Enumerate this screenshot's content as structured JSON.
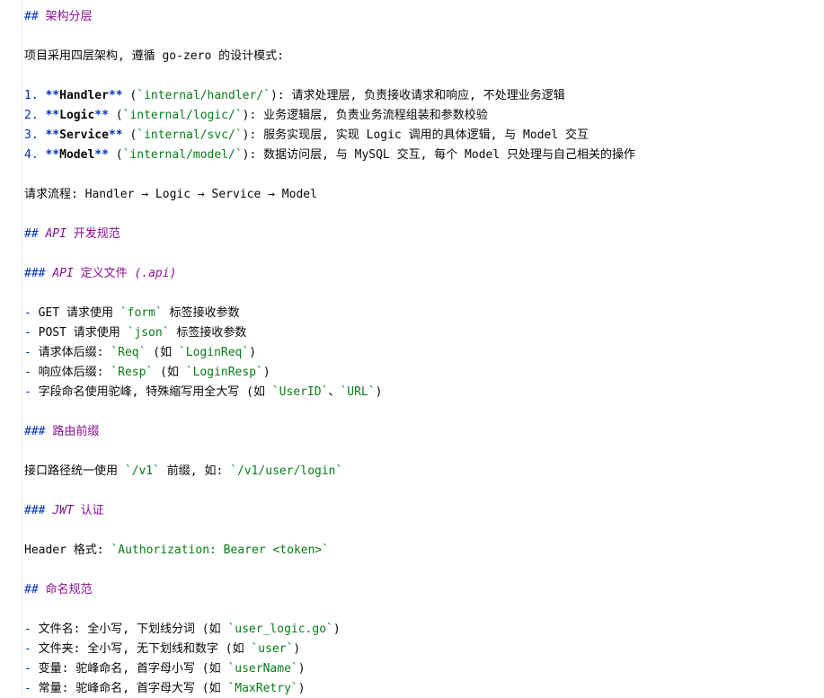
{
  "doc": {
    "lines": [
      [
        {
          "t": "## ",
          "c": "head"
        },
        {
          "t": "架构分层",
          "c": "head-text"
        }
      ],
      [],
      [
        {
          "t": "项目采用四层架构, 遵循 go-zero 的设计模式:",
          "c": "txt"
        }
      ],
      [],
      [
        {
          "t": "1. ",
          "c": "num"
        },
        {
          "t": "**",
          "c": "star"
        },
        {
          "t": "Handler",
          "c": "bold"
        },
        {
          "t": "**",
          "c": "star"
        },
        {
          "t": " (",
          "c": "txt"
        },
        {
          "t": "`",
          "c": "bt"
        },
        {
          "t": "internal/handler/",
          "c": "code"
        },
        {
          "t": "`",
          "c": "bt"
        },
        {
          "t": "): 请求处理层, 负责接收请求和响应, 不处理业务逻辑",
          "c": "txt"
        }
      ],
      [
        {
          "t": "2. ",
          "c": "num"
        },
        {
          "t": "**",
          "c": "star"
        },
        {
          "t": "Logic",
          "c": "bold"
        },
        {
          "t": "**",
          "c": "star"
        },
        {
          "t": " (",
          "c": "txt"
        },
        {
          "t": "`",
          "c": "bt"
        },
        {
          "t": "internal/logic/",
          "c": "code"
        },
        {
          "t": "`",
          "c": "bt"
        },
        {
          "t": "): 业务逻辑层, 负责业务流程组装和参数校验",
          "c": "txt"
        }
      ],
      [
        {
          "t": "3. ",
          "c": "num"
        },
        {
          "t": "**",
          "c": "star"
        },
        {
          "t": "Service",
          "c": "bold"
        },
        {
          "t": "**",
          "c": "star"
        },
        {
          "t": " (",
          "c": "txt"
        },
        {
          "t": "`",
          "c": "bt"
        },
        {
          "t": "internal/svc/",
          "c": "code"
        },
        {
          "t": "`",
          "c": "bt"
        },
        {
          "t": "): 服务实现层, 实现 Logic 调用的具体逻辑, 与 Model 交互",
          "c": "txt"
        }
      ],
      [
        {
          "t": "4. ",
          "c": "num"
        },
        {
          "t": "**",
          "c": "star"
        },
        {
          "t": "Model",
          "c": "bold"
        },
        {
          "t": "**",
          "c": "star"
        },
        {
          "t": " (",
          "c": "txt"
        },
        {
          "t": "`",
          "c": "bt"
        },
        {
          "t": "internal/model/",
          "c": "code"
        },
        {
          "t": "`",
          "c": "bt"
        },
        {
          "t": "): 数据访问层, 与 MySQL 交互, 每个 Model 只处理与自己相关的操作",
          "c": "txt"
        }
      ],
      [],
      [
        {
          "t": "请求流程: Handler → Logic → Service → Model",
          "c": "txt"
        }
      ],
      [],
      [
        {
          "t": "## ",
          "c": "head"
        },
        {
          "t": "API",
          "c": "head-text it"
        },
        {
          "t": " 开发规范",
          "c": "head-text"
        }
      ],
      [],
      [
        {
          "t": "### ",
          "c": "head"
        },
        {
          "t": "API",
          "c": "head-text it"
        },
        {
          "t": " 定义文件 ",
          "c": "head-text"
        },
        {
          "t": "(.api)",
          "c": "head-text it"
        }
      ],
      [],
      [
        {
          "t": "- ",
          "c": "dash"
        },
        {
          "t": "GET 请求使用 ",
          "c": "txt"
        },
        {
          "t": "`",
          "c": "bt"
        },
        {
          "t": "form",
          "c": "code"
        },
        {
          "t": "`",
          "c": "bt"
        },
        {
          "t": " 标签接收参数",
          "c": "txt"
        }
      ],
      [
        {
          "t": "- ",
          "c": "dash"
        },
        {
          "t": "POST 请求使用 ",
          "c": "txt"
        },
        {
          "t": "`",
          "c": "bt"
        },
        {
          "t": "json",
          "c": "code"
        },
        {
          "t": "`",
          "c": "bt"
        },
        {
          "t": " 标签接收参数",
          "c": "txt"
        }
      ],
      [
        {
          "t": "- ",
          "c": "dash"
        },
        {
          "t": "请求体后缀: ",
          "c": "txt"
        },
        {
          "t": "`",
          "c": "bt"
        },
        {
          "t": "Req",
          "c": "code"
        },
        {
          "t": "`",
          "c": "bt"
        },
        {
          "t": " (如 ",
          "c": "txt"
        },
        {
          "t": "`",
          "c": "bt"
        },
        {
          "t": "LoginReq",
          "c": "code"
        },
        {
          "t": "`",
          "c": "bt"
        },
        {
          "t": ")",
          "c": "txt"
        }
      ],
      [
        {
          "t": "- ",
          "c": "dash"
        },
        {
          "t": "响应体后缀: ",
          "c": "txt"
        },
        {
          "t": "`",
          "c": "bt"
        },
        {
          "t": "Resp",
          "c": "code"
        },
        {
          "t": "`",
          "c": "bt"
        },
        {
          "t": " (如 ",
          "c": "txt"
        },
        {
          "t": "`",
          "c": "bt"
        },
        {
          "t": "LoginResp",
          "c": "code"
        },
        {
          "t": "`",
          "c": "bt"
        },
        {
          "t": ")",
          "c": "txt"
        }
      ],
      [
        {
          "t": "- ",
          "c": "dash"
        },
        {
          "t": "字段命名使用驼峰, 特殊缩写用全大写 (如 ",
          "c": "txt"
        },
        {
          "t": "`",
          "c": "bt"
        },
        {
          "t": "UserID",
          "c": "code"
        },
        {
          "t": "`",
          "c": "bt"
        },
        {
          "t": "、",
          "c": "txt"
        },
        {
          "t": "`",
          "c": "bt"
        },
        {
          "t": "URL",
          "c": "code"
        },
        {
          "t": "`",
          "c": "bt"
        },
        {
          "t": ")",
          "c": "txt"
        }
      ],
      [],
      [
        {
          "t": "### ",
          "c": "head"
        },
        {
          "t": "路由前缀",
          "c": "head-text"
        }
      ],
      [],
      [
        {
          "t": "接口路径统一使用 ",
          "c": "txt"
        },
        {
          "t": "`",
          "c": "bt"
        },
        {
          "t": "/v1",
          "c": "code"
        },
        {
          "t": "`",
          "c": "bt"
        },
        {
          "t": " 前缀, 如: ",
          "c": "txt"
        },
        {
          "t": "`",
          "c": "bt"
        },
        {
          "t": "/v1/user/login",
          "c": "code"
        },
        {
          "t": "`",
          "c": "bt"
        }
      ],
      [],
      [
        {
          "t": "### ",
          "c": "head"
        },
        {
          "t": "JWT",
          "c": "head-text it"
        },
        {
          "t": " 认证",
          "c": "head-text"
        }
      ],
      [],
      [
        {
          "t": "Header 格式: ",
          "c": "txt"
        },
        {
          "t": "`",
          "c": "bt"
        },
        {
          "t": "Authorization: Bearer <token>",
          "c": "code"
        },
        {
          "t": "`",
          "c": "bt"
        }
      ],
      [],
      [
        {
          "t": "## ",
          "c": "head"
        },
        {
          "t": "命名规范",
          "c": "head-text"
        }
      ],
      [],
      [
        {
          "t": "- ",
          "c": "dash"
        },
        {
          "t": "文件名: 全小写, 下划线分词 (如 ",
          "c": "txt"
        },
        {
          "t": "`",
          "c": "bt"
        },
        {
          "t": "user_logic.go",
          "c": "code"
        },
        {
          "t": "`",
          "c": "bt"
        },
        {
          "t": ")",
          "c": "txt"
        }
      ],
      [
        {
          "t": "- ",
          "c": "dash"
        },
        {
          "t": "文件夹: 全小写, 无下划线和数字 (如 ",
          "c": "txt"
        },
        {
          "t": "`",
          "c": "bt"
        },
        {
          "t": "user",
          "c": "code"
        },
        {
          "t": "`",
          "c": "bt"
        },
        {
          "t": ")",
          "c": "txt"
        }
      ],
      [
        {
          "t": "- ",
          "c": "dash"
        },
        {
          "t": "变量: 驼峰命名, 首字母小写 (如 ",
          "c": "txt"
        },
        {
          "t": "`",
          "c": "bt"
        },
        {
          "t": "userName",
          "c": "code"
        },
        {
          "t": "`",
          "c": "bt"
        },
        {
          "t": ")",
          "c": "txt"
        }
      ],
      [
        {
          "t": "- ",
          "c": "dash"
        },
        {
          "t": "常量: 驼峰命名, 首字母大写 (如 ",
          "c": "txt"
        },
        {
          "t": "`",
          "c": "bt"
        },
        {
          "t": "MaxRetry",
          "c": "code"
        },
        {
          "t": "`",
          "c": "bt"
        },
        {
          "t": ")",
          "c": "txt"
        }
      ]
    ]
  }
}
